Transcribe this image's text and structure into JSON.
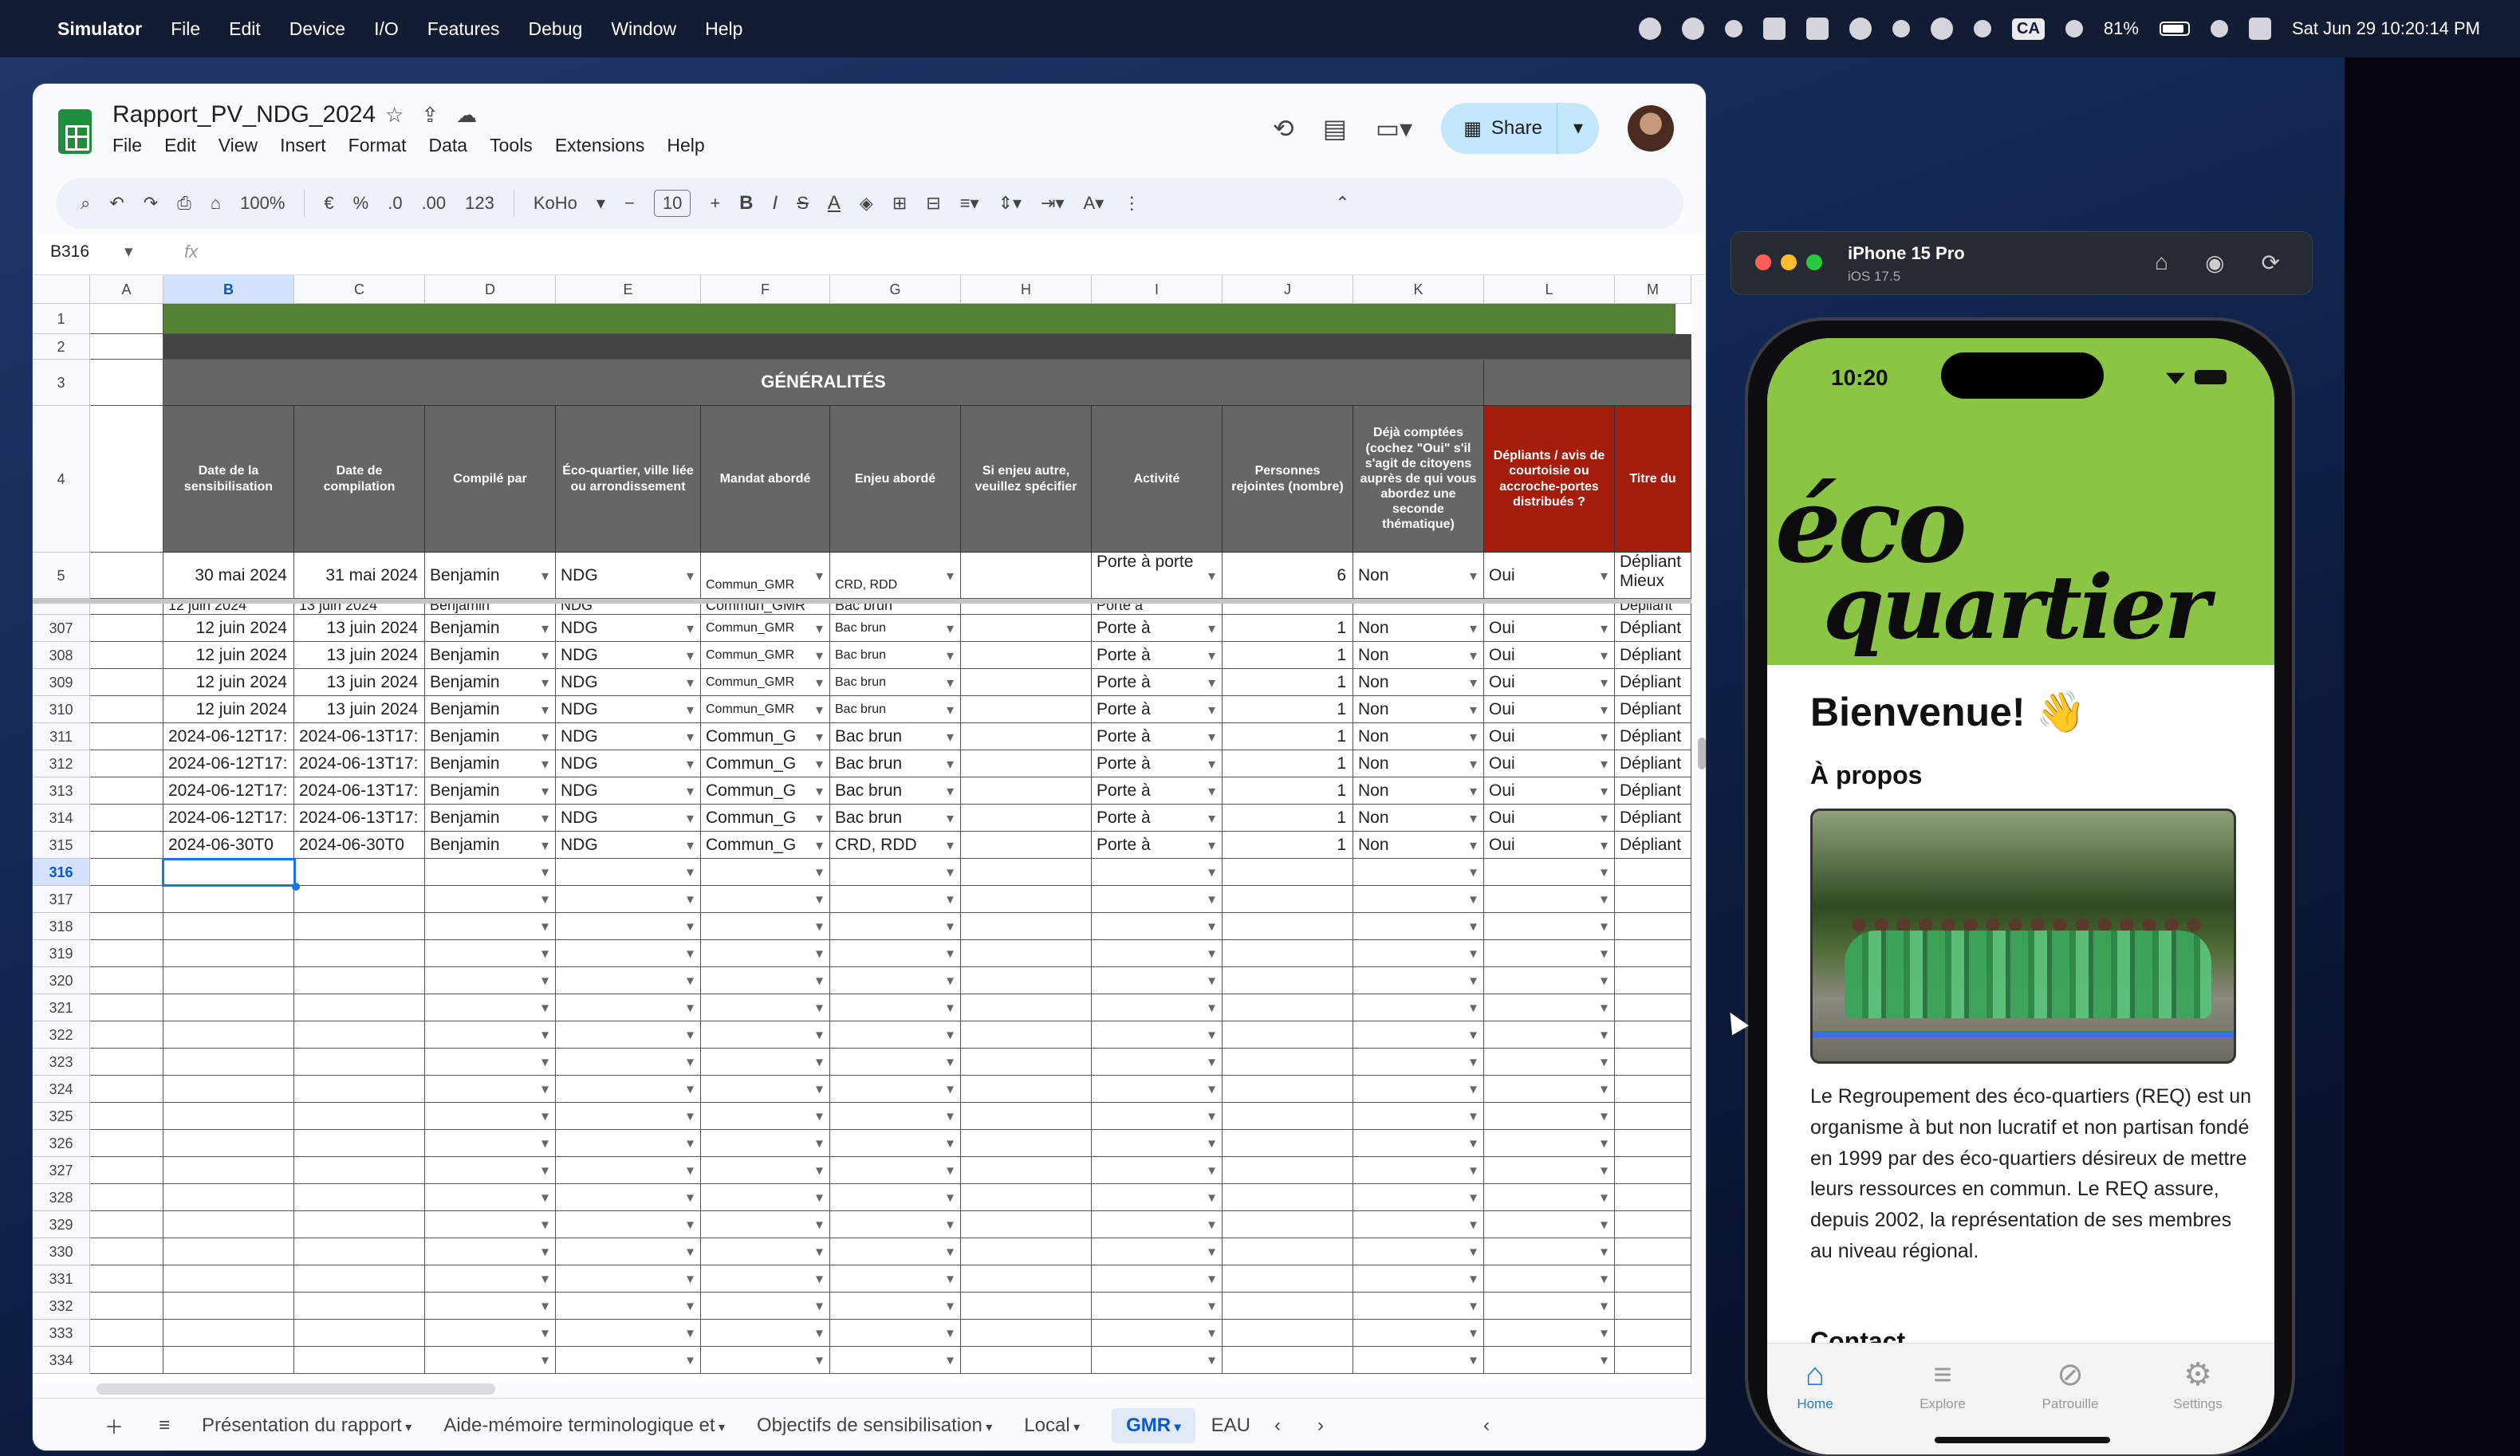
{
  "menubar": {
    "app": "Simulator",
    "items": [
      "File",
      "Edit",
      "Device",
      "I/O",
      "Features",
      "Debug",
      "Window",
      "Help"
    ],
    "ca": "CA",
    "battery": "81%",
    "clock": "Sat Jun 29  10:20:14 PM"
  },
  "sheets": {
    "title": "Rapport_PV_NDG_2024",
    "menus": [
      "File",
      "Edit",
      "View",
      "Insert",
      "Format",
      "Data",
      "Tools",
      "Extensions",
      "Help"
    ],
    "share": "Share",
    "toolbar": {
      "zoom": "100%",
      "currency": "€",
      "percent": "%",
      "dec_less": ".0",
      "dec_more": ".00",
      "numfmt": "123",
      "font": "KoHo",
      "minus": "−",
      "size": "10",
      "plus": "+",
      "bold": "B",
      "italic": "I",
      "strike": "S",
      "color": "A",
      "more": "⋮"
    },
    "namebox": "B316",
    "fx": "fx",
    "columns": [
      "A",
      "B",
      "C",
      "D",
      "E",
      "F",
      "G",
      "H",
      "I",
      "J",
      "K",
      "L",
      "M"
    ],
    "section": "GÉNÉRALITÉS",
    "headers": {
      "b": "Date de la sensibilisation",
      "c": "Date de compilation",
      "d": "Compilé par",
      "e": "Éco-quartier, ville liée ou arrondissement",
      "f": "Mandat abordé",
      "g": "Enjeu abordé",
      "h": "Si enjeu autre, veuillez spécifier",
      "i": "Activité",
      "j": "Personnes rejointes (nombre)",
      "k": "Déjà comptées (cochez \"Oui\" s'il s'agit de citoyens auprès de qui vous abordez une seconde thématique)",
      "l": "Dépliants / avis de courtoisie ou accroche-portes distribués ?",
      "m": "Titre du"
    },
    "row5": {
      "num": "5",
      "b": "30 mai 2024",
      "c": "31 mai 2024",
      "d": "Benjamin",
      "e": "NDG",
      "f": "Commun_GMR",
      "g": "CRD, RDD",
      "i": "Porte à porte",
      "j": "6",
      "k": "Non",
      "l": "Oui",
      "m": "Dépliant Mieux"
    },
    "partial": {
      "b": "12 juin 2024",
      "c": "13 juin 2024",
      "d": "Benjamin",
      "e": "NDG",
      "f": "Commun_GMR",
      "g": "Bac brun",
      "i": "Porte à",
      "m": "Dépliant"
    },
    "rows": [
      {
        "num": "307",
        "b": "12 juin 2024",
        "c": "13 juin 2024",
        "d": "Benjamin",
        "e": "NDG",
        "f": "Commun_GMR",
        "g": "Bac brun",
        "i": "Porte à",
        "j": "1",
        "k": "Non",
        "l": "Oui",
        "m": "Dépliant"
      },
      {
        "num": "308",
        "b": "12 juin 2024",
        "c": "13 juin 2024",
        "d": "Benjamin",
        "e": "NDG",
        "f": "Commun_GMR",
        "g": "Bac brun",
        "i": "Porte à",
        "j": "1",
        "k": "Non",
        "l": "Oui",
        "m": "Dépliant"
      },
      {
        "num": "309",
        "b": "12 juin 2024",
        "c": "13 juin 2024",
        "d": "Benjamin",
        "e": "NDG",
        "f": "Commun_GMR",
        "g": "Bac brun",
        "i": "Porte à",
        "j": "1",
        "k": "Non",
        "l": "Oui",
        "m": "Dépliant"
      },
      {
        "num": "310",
        "b": "12 juin 2024",
        "c": "13 juin 2024",
        "d": "Benjamin",
        "e": "NDG",
        "f": "Commun_GMR",
        "g": "Bac brun",
        "i": "Porte à",
        "j": "1",
        "k": "Non",
        "l": "Oui",
        "m": "Dépliant"
      },
      {
        "num": "311",
        "b": "2024-06-12T17:",
        "c": "2024-06-13T17:",
        "d": "Benjamin",
        "e": "NDG",
        "f": "Commun_G",
        "g": "Bac brun",
        "i": "Porte à",
        "j": "1",
        "k": "Non",
        "l": "Oui",
        "m": "Dépliant"
      },
      {
        "num": "312",
        "b": "2024-06-12T17:",
        "c": "2024-06-13T17:",
        "d": "Benjamin",
        "e": "NDG",
        "f": "Commun_G",
        "g": "Bac brun",
        "i": "Porte à",
        "j": "1",
        "k": "Non",
        "l": "Oui",
        "m": "Dépliant"
      },
      {
        "num": "313",
        "b": "2024-06-12T17:",
        "c": "2024-06-13T17:",
        "d": "Benjamin",
        "e": "NDG",
        "f": "Commun_G",
        "g": "Bac brun",
        "i": "Porte à",
        "j": "1",
        "k": "Non",
        "l": "Oui",
        "m": "Dépliant"
      },
      {
        "num": "314",
        "b": "2024-06-12T17:",
        "c": "2024-06-13T17:",
        "d": "Benjamin",
        "e": "NDG",
        "f": "Commun_G",
        "g": "Bac brun",
        "i": "Porte à",
        "j": "1",
        "k": "Non",
        "l": "Oui",
        "m": "Dépliant"
      },
      {
        "num": "315",
        "b": "2024-06-30T0",
        "c": "2024-06-30T0",
        "d": "Benjamin",
        "e": "NDG",
        "f": "Commun_G",
        "g": "CRD, RDD",
        "i": "Porte à",
        "j": "1",
        "k": "Non",
        "l": "Oui",
        "m": "Dépliant"
      }
    ],
    "empty_rows": [
      "316",
      "317",
      "318",
      "319",
      "320",
      "321",
      "322",
      "323",
      "324",
      "325",
      "326",
      "327",
      "328",
      "329",
      "330",
      "331",
      "332",
      "333",
      "334"
    ],
    "tabs": [
      "Présentation du rapport",
      "Aide-mémoire terminologique et",
      "Objectifs de sensibilisation",
      "Local",
      "GMR",
      "EAU"
    ]
  },
  "simulator": {
    "device": "iPhone 15 Pro",
    "os": "iOS 17.5"
  },
  "phone": {
    "time": "10:20",
    "logo1": "éco",
    "logo2": "quartier",
    "welcome": "Bienvenue! 👋",
    "section": "À propos",
    "desc": "Le Regroupement des éco-quartiers (REQ) est un organisme à but non lucratif et non partisan fondé en 1999 par des éco-quartiers désireux de mettre leurs ressources en commun. Le REQ assure, depuis 2002, la représentation de ses membres au niveau régional.",
    "contact": "Contact",
    "tabs": [
      "Home",
      "Explore",
      "Patrouille",
      "Settings"
    ]
  },
  "colors": {
    "green_band": "#548235",
    "header_gray": "#666666",
    "header_red": "#a51d0c",
    "app_green": "#8cc443",
    "accent": "#2a78c9"
  }
}
